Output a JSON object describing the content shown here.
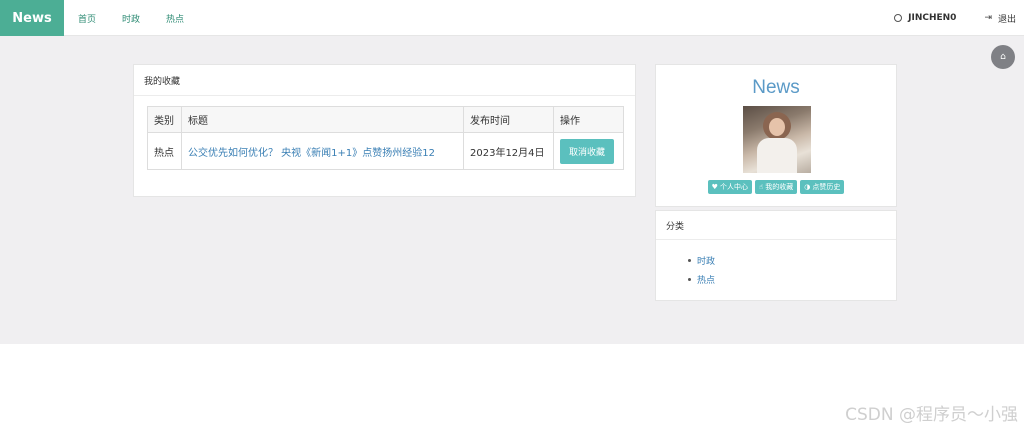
{
  "navbar": {
    "brand": "News",
    "links": [
      "首页",
      "时政",
      "热点"
    ],
    "user": "JINCHEN0",
    "logout": "退出"
  },
  "favorites": {
    "title": "我的收藏",
    "columns": [
      "类别",
      "标题",
      "发布时间",
      "操作"
    ],
    "rows": [
      {
        "category": "热点",
        "headline": "公交优先如何优化？ 央视《新闻1+1》点赞扬州经验12",
        "date": "2023年12月4日",
        "action": "取消收藏"
      }
    ]
  },
  "profile": {
    "title": "News",
    "buttons": [
      "个人中心",
      "我的收藏",
      "点赞历史"
    ]
  },
  "categories": {
    "title": "分类",
    "items": [
      "时政",
      "热点"
    ]
  },
  "watermark": "CSDN @程序员～小强",
  "icons": {
    "home": "home-icon",
    "user": "user-icon",
    "logout": "logout-icon"
  },
  "colors": {
    "brand_bg": "#4cae95",
    "accent": "#5bc0be",
    "link": "#3a7fb4",
    "background": "#f0eff1"
  }
}
